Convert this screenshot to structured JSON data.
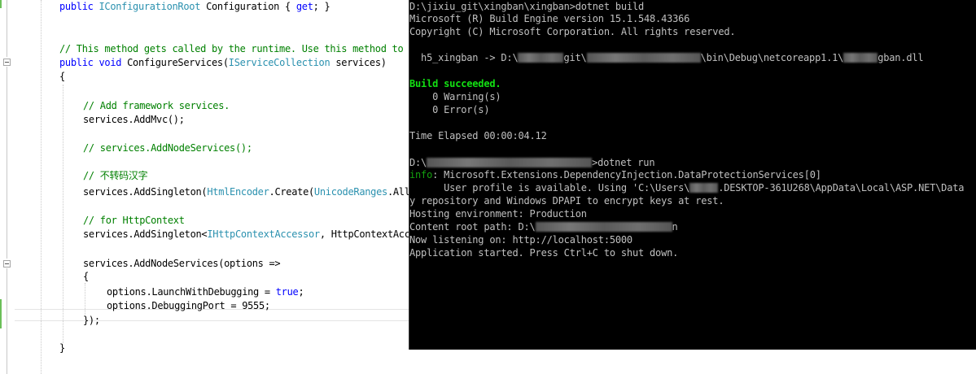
{
  "editor": {
    "lines": [
      [
        {
          "t": "public ",
          "c": "kw"
        },
        {
          "t": "IConfigurationRoot",
          "c": "ty"
        },
        {
          "t": " Configuration { "
        },
        {
          "t": "get",
          "c": "kw"
        },
        {
          "t": "; }"
        }
      ],
      [
        {
          "t": "// This method gets called by the runtime. Use this method to",
          "c": "cm"
        }
      ],
      [
        {
          "t": "public ",
          "c": "kw"
        },
        {
          "t": "void",
          "c": "kw"
        },
        {
          "t": " ConfigureServices("
        },
        {
          "t": "IServiceCollection",
          "c": "ty"
        },
        {
          "t": " services)"
        }
      ],
      [
        {
          "t": "{"
        }
      ],
      [
        {
          "t": "// Add framework services.",
          "c": "cm"
        }
      ],
      [
        {
          "t": "services.AddMvc();"
        }
      ],
      [
        {
          "t": "// services.AddNodeServices();",
          "c": "cm"
        }
      ],
      [
        {
          "t": "// 不转码汉字",
          "c": "cm"
        }
      ],
      [
        {
          "t": "services.AddSingleton("
        },
        {
          "t": "HtmlEncoder",
          "c": "ty"
        },
        {
          "t": ".Create("
        },
        {
          "t": "UnicodeRanges",
          "c": "ty"
        },
        {
          "t": ".All"
        }
      ],
      [
        {
          "t": "// for HttpContext",
          "c": "cm"
        }
      ],
      [
        {
          "t": "services.AddSingleton<"
        },
        {
          "t": "IHttpContextAccessor",
          "c": "ty"
        },
        {
          "t": ", HttpContextAccessor>();"
        }
      ],
      [
        {
          "t": "services.AddNodeServices(options =>"
        }
      ],
      [
        {
          "t": "{"
        }
      ],
      [
        {
          "t": "options.LaunchWithDebugging = "
        },
        {
          "t": "true",
          "c": "kw"
        },
        {
          "t": ";"
        }
      ],
      [
        {
          "t": "options.DebuggingPort = 9555;"
        }
      ],
      [
        {
          "t": "});"
        }
      ],
      [
        {
          "t": "}"
        }
      ]
    ]
  },
  "console": {
    "lines": [
      [
        {
          "t": "D:\\jixiu_git\\xingban\\xingban>dotnet build"
        }
      ],
      [
        {
          "t": "Microsoft (R) Build Engine version 15.1.548.43366"
        }
      ],
      [
        {
          "t": "Copyright (C) Microsoft Corporation. All rights reserved."
        }
      ],
      [
        {
          "t": "  h5_xingban -> D:\\"
        },
        {
          "blur": 8
        },
        {
          "t": "git\\"
        },
        {
          "blur": 20
        },
        {
          "t": "\\bin\\Debug\\netcoreapp1.1\\"
        },
        {
          "blur": 6
        },
        {
          "t": "gban.dll"
        }
      ],
      [
        {
          "t": "Build succeeded.",
          "c": "green"
        }
      ],
      [
        {
          "t": "    0 Warning(s)"
        }
      ],
      [
        {
          "t": "    0 Error(s)"
        }
      ],
      [
        {
          "t": "Time Elapsed 00:00:04.12"
        }
      ],
      [
        {
          "t": "D:\\"
        },
        {
          "blur": 29
        },
        {
          "t": ">dotnet run"
        }
      ],
      [
        {
          "t": "info",
          "c": "info"
        },
        {
          "t": ": Microsoft.Extensions.DependencyInjection.DataProtectionServices[0]"
        }
      ],
      [
        {
          "t": "      User profile is available. Using 'C:\\Users\\"
        },
        {
          "blur": 5
        },
        {
          "t": ".DESKTOP-361U268\\AppData\\Local\\ASP.NET\\Data"
        }
      ],
      [
        {
          "t": "y repository and Windows DPAPI to encrypt keys at rest."
        }
      ],
      [
        {
          "t": "Hosting environment: Production"
        }
      ],
      [
        {
          "t": "Content root path: D:\\"
        },
        {
          "blur": 24
        },
        {
          "t": "n"
        }
      ],
      [
        {
          "t": "Now listening on: http://localhost:5000"
        }
      ],
      [
        {
          "t": "Application started. Press Ctrl+C to shut down."
        }
      ]
    ]
  }
}
